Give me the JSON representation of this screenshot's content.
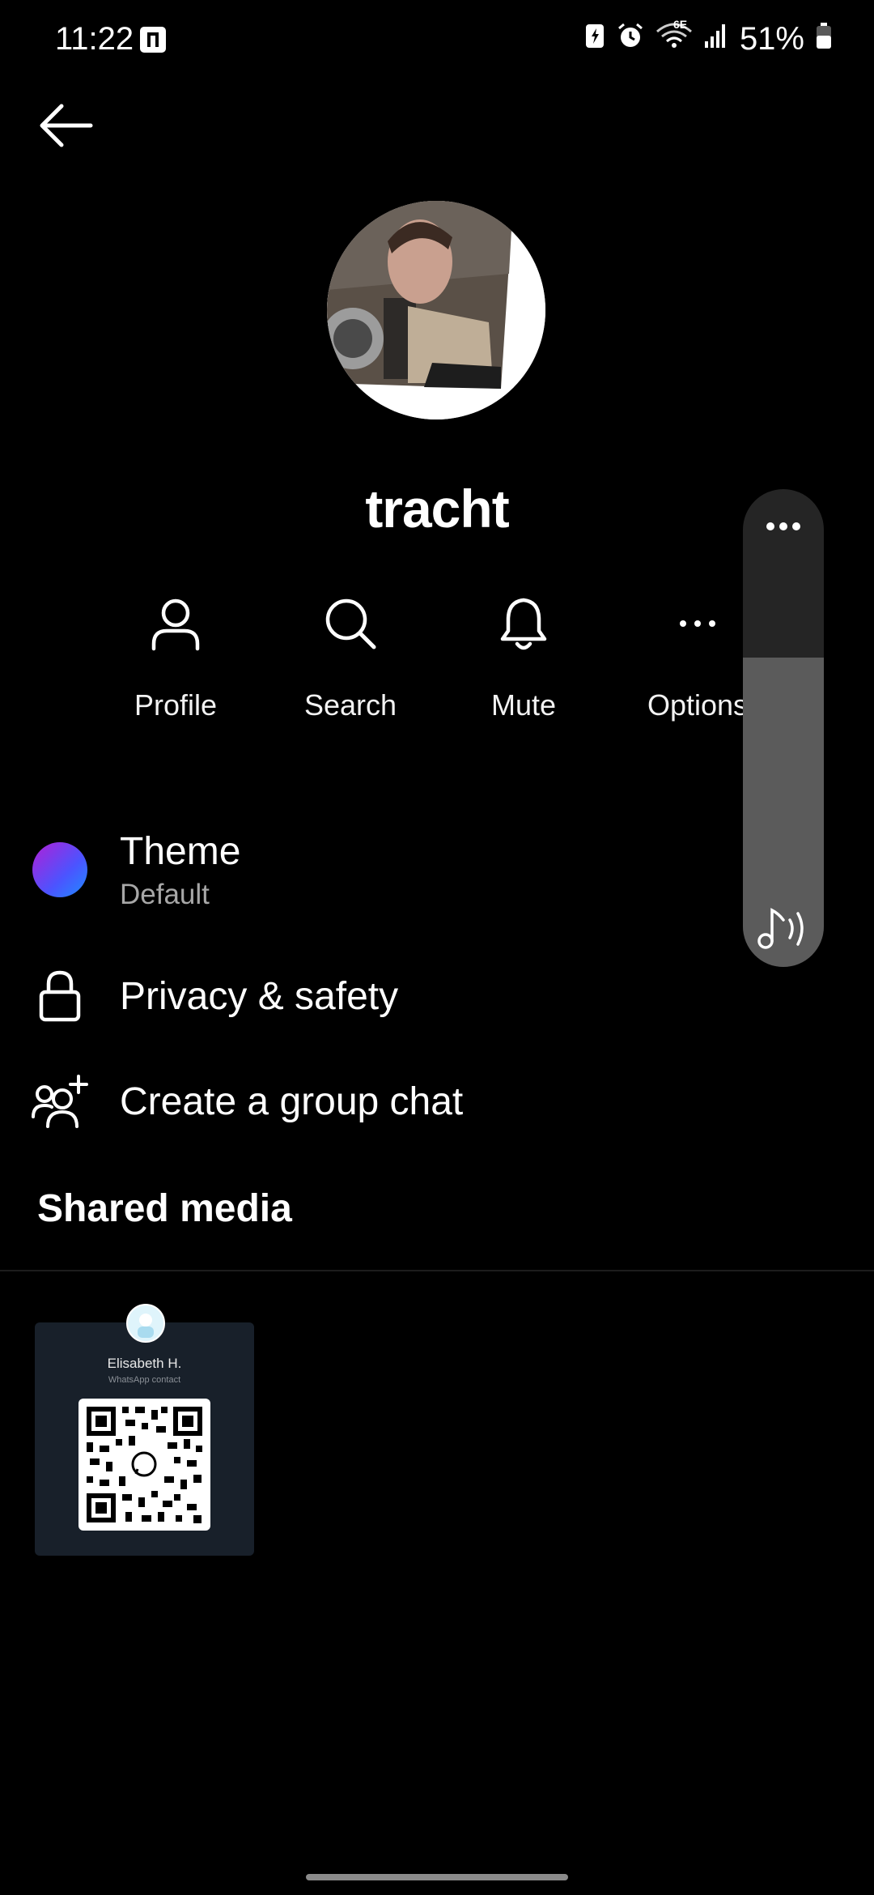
{
  "status_bar": {
    "time": "11:22",
    "network": "6E",
    "battery": "51%"
  },
  "header": {
    "back_label": "Back"
  },
  "profile": {
    "name": "tracht"
  },
  "actions": [
    {
      "label": "Profile",
      "icon": "person-icon"
    },
    {
      "label": "Search",
      "icon": "search-icon"
    },
    {
      "label": "Mute",
      "icon": "bell-icon"
    },
    {
      "label": "Options",
      "icon": "more-horizontal-icon"
    }
  ],
  "settings": {
    "theme": {
      "label": "Theme",
      "value": "Default"
    },
    "privacy": {
      "label": "Privacy & safety"
    },
    "group": {
      "label": "Create a group chat"
    }
  },
  "shared_media": {
    "title": "Shared media",
    "items": [
      {
        "contact_name": "Elisabeth H.",
        "subtitle": "WhatsApp contact"
      }
    ]
  },
  "colors": {
    "background": "#000000",
    "theme_gradient_start": "#b21fd6",
    "theme_gradient_end": "#1f8bff",
    "card_bg": "#18202a"
  }
}
